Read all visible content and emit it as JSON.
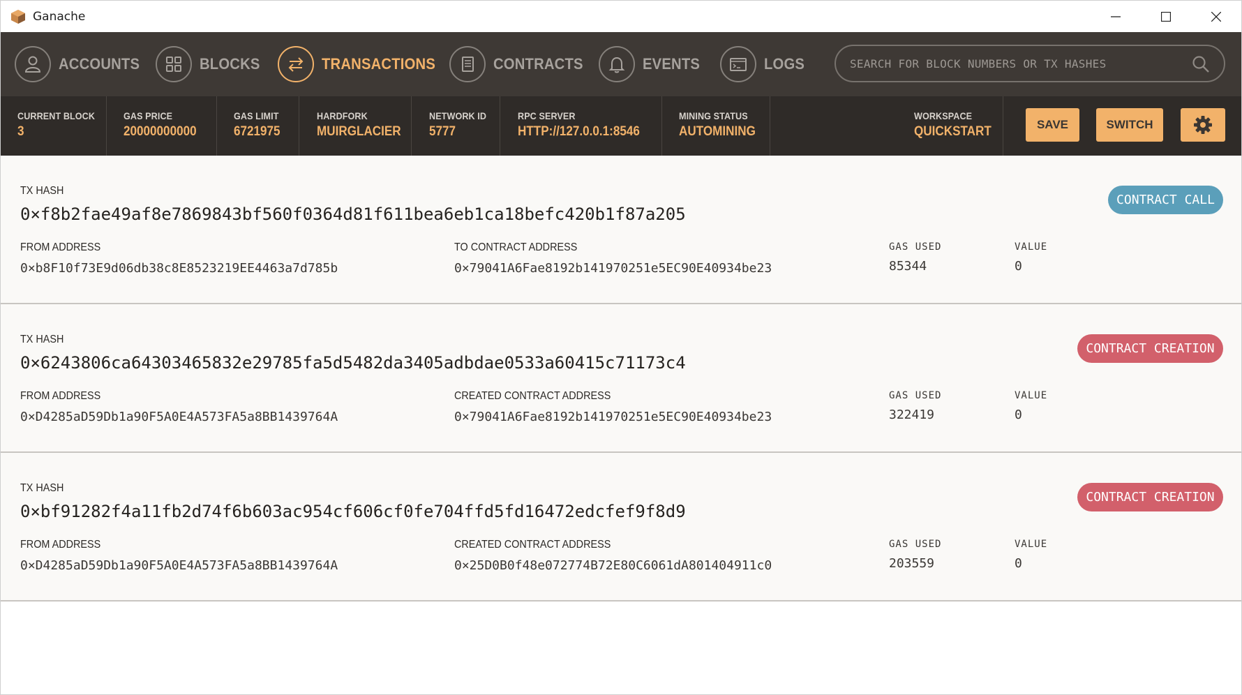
{
  "window": {
    "title": "Ganache"
  },
  "nav": {
    "items": [
      {
        "label": "ACCOUNTS",
        "icon": "person-icon",
        "active": false
      },
      {
        "label": "BLOCKS",
        "icon": "grid-icon",
        "active": false
      },
      {
        "label": "TRANSACTIONS",
        "icon": "swap-arrows-icon",
        "active": true
      },
      {
        "label": "CONTRACTS",
        "icon": "document-icon",
        "active": false
      },
      {
        "label": "EVENTS",
        "icon": "bell-icon",
        "active": false
      },
      {
        "label": "LOGS",
        "icon": "terminal-icon",
        "active": false
      }
    ],
    "search_placeholder": "SEARCH FOR BLOCK NUMBERS OR TX HASHES"
  },
  "status": {
    "current_block": {
      "label": "CURRENT BLOCK",
      "value": "3"
    },
    "gas_price": {
      "label": "GAS PRICE",
      "value": "20000000000"
    },
    "gas_limit": {
      "label": "GAS LIMIT",
      "value": "6721975"
    },
    "hardfork": {
      "label": "HARDFORK",
      "value": "MUIRGLACIER"
    },
    "network_id": {
      "label": "NETWORK ID",
      "value": "5777"
    },
    "rpc_server": {
      "label": "RPC SERVER",
      "value": "HTTP://127.0.0.1:8546"
    },
    "mining_status": {
      "label": "MINING STATUS",
      "value": "AUTOMINING"
    },
    "workspace": {
      "label": "WORKSPACE",
      "value": "QUICKSTART"
    },
    "save_label": "SAVE",
    "switch_label": "SWITCH"
  },
  "colors": {
    "accent": "#f2b26a",
    "contract_call": "#5b9fba",
    "contract_creation": "#d2606b"
  },
  "transactions": [
    {
      "hash_label": "TX HASH",
      "hash": "0×f8b2fae49af8e7869843bf560f0364d81f611bea6eb1ca18befc420b1f87a205",
      "from_label": "FROM ADDRESS",
      "from": "0×b8F10f73E9d06db38c8E8523219EE4463a7d785b",
      "to_label": "TO CONTRACT ADDRESS",
      "to": "0×79041A6Fae8192b141970251e5EC90E40934be23",
      "gas_label": "GAS USED",
      "gas": "85344",
      "value_label": "VALUE",
      "value": "0",
      "badge": "CONTRACT CALL",
      "badge_type": "call"
    },
    {
      "hash_label": "TX HASH",
      "hash": "0×6243806ca64303465832e29785fa5d5482da3405adbdae0533a60415c71173c4",
      "from_label": "FROM ADDRESS",
      "from": "0×D4285aD59Db1a90F5A0E4A573FA5a8BB1439764A",
      "to_label": "CREATED CONTRACT ADDRESS",
      "to": "0×79041A6Fae8192b141970251e5EC90E40934be23",
      "gas_label": "GAS USED",
      "gas": "322419",
      "value_label": "VALUE",
      "value": "0",
      "badge": "CONTRACT CREATION",
      "badge_type": "creation"
    },
    {
      "hash_label": "TX HASH",
      "hash": "0×bf91282f4a11fb2d74f6b603ac954cf606cf0fe704ffd5fd16472edcfef9f8d9",
      "from_label": "FROM ADDRESS",
      "from": "0×D4285aD59Db1a90F5A0E4A573FA5a8BB1439764A",
      "to_label": "CREATED CONTRACT ADDRESS",
      "to": "0×25D0B0f48e072774B72E80C6061dA801404911c0",
      "gas_label": "GAS USED",
      "gas": "203559",
      "value_label": "VALUE",
      "value": "0",
      "badge": "CONTRACT CREATION",
      "badge_type": "creation"
    }
  ]
}
